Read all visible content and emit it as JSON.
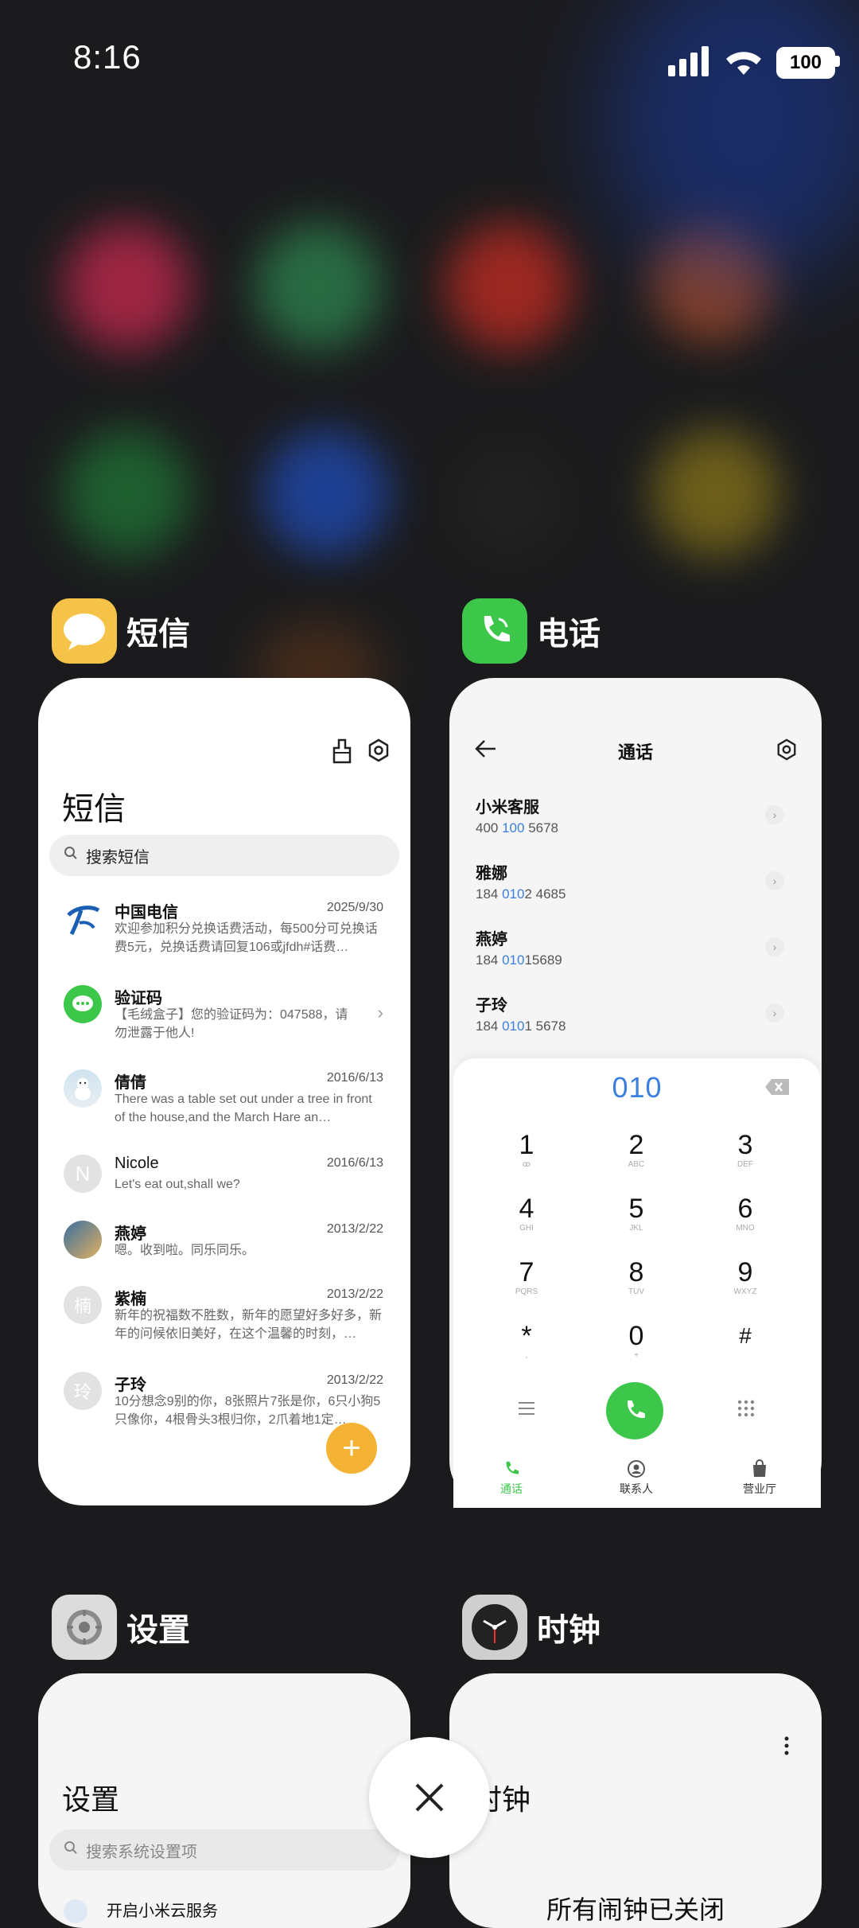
{
  "status_bar": {
    "time": "8:16",
    "battery": "100"
  },
  "apps": {
    "messages": {
      "app_name": "短信",
      "title": "短信",
      "search_placeholder": "搜索短信",
      "items": [
        {
          "name": "中国电信",
          "date": "2025/9/30",
          "preview": "欢迎参加积分兑换话费活动，每500分可兑换话费5元，兑换话费请回复106或jfdh#话费…"
        },
        {
          "name": "验证码",
          "date": "",
          "preview": "【毛绒盒子】您的验证码为：047588，请勿泄露于他人!"
        },
        {
          "name": "倩倩",
          "date": "2016/6/13",
          "preview": "There was a table set out under a tree in front of the house,and the March Hare an…"
        },
        {
          "name": "Nicole",
          "date": "2016/6/13",
          "preview": "Let's eat out,shall we?",
          "initial": "N"
        },
        {
          "name": "燕婷",
          "date": "2013/2/22",
          "preview": "嗯。收到啦。同乐同乐。"
        },
        {
          "name": "紫楠",
          "date": "2013/2/22",
          "preview": "新年的祝福数不胜数，新年的愿望好多好多，新年的问候依旧美好，在这个温馨的时刻，…",
          "initial": "楠"
        },
        {
          "name": "子玲",
          "date": "2013/2/22",
          "preview": "10分想念9别的你，8张照片7张是你，6只小狗5只像你，4根骨头3根归你，2爪着地1定…",
          "initial": "玲"
        }
      ],
      "fab": "+"
    },
    "phone": {
      "app_name": "电话",
      "title": "通话",
      "contacts": [
        {
          "name": "小米客服",
          "num_pre": "400 ",
          "num_hl": "100",
          "num_post": " 5678"
        },
        {
          "name": "雅娜",
          "num_pre": "184 ",
          "num_hl": "010",
          "num_post": "2 4685"
        },
        {
          "name": "燕婷",
          "num_pre": "184 ",
          "num_hl": "010",
          "num_post": "15689"
        },
        {
          "name": "子玲",
          "num_pre": "184 ",
          "num_hl": "010",
          "num_post": "1 5678"
        }
      ],
      "dialed": "010",
      "keys": [
        {
          "d": "1",
          "l": "ꝏ"
        },
        {
          "d": "2",
          "l": "ABC"
        },
        {
          "d": "3",
          "l": "DEF"
        },
        {
          "d": "4",
          "l": "GHI"
        },
        {
          "d": "5",
          "l": "JKL"
        },
        {
          "d": "6",
          "l": "MNO"
        },
        {
          "d": "7",
          "l": "PQRS"
        },
        {
          "d": "8",
          "l": "TUV"
        },
        {
          "d": "9",
          "l": "WXYZ"
        },
        {
          "d": "*",
          "l": ","
        },
        {
          "d": "0",
          "l": "+"
        },
        {
          "d": "#",
          "l": ""
        }
      ],
      "tabs": [
        "通话",
        "联系人",
        "营业厅"
      ]
    },
    "settings": {
      "app_name": "设置",
      "title": "设置",
      "search_placeholder": "搜索系统设置项",
      "first_item": "开启小米云服务"
    },
    "clock": {
      "app_name": "时钟",
      "title": "时钟",
      "status": "所有闹钟已关闭"
    }
  },
  "colors": {
    "accent_blue": "#3a7fe0",
    "call_green": "#3cc74a",
    "fab_orange": "#f5b335"
  }
}
